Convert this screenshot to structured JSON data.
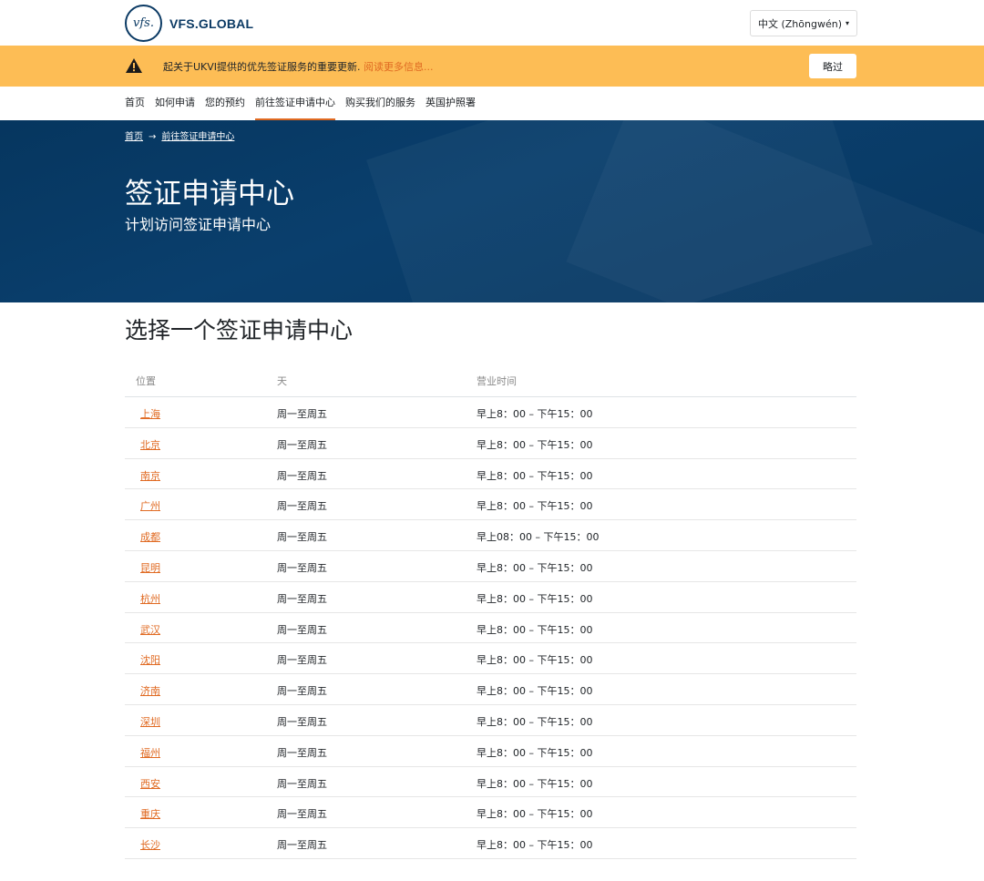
{
  "header": {
    "logo_mark": "vfs.",
    "logo_text": "VFS.GLOBAL",
    "language": "中文 (Zhōngwén)",
    "language_caret": "▾"
  },
  "alert": {
    "text": "起关于UKVI提供的优先签证服务的重要更新. ",
    "link_text": "阅读更多信息...",
    "skip_label": "略过"
  },
  "nav": {
    "items": [
      "首页",
      "如何申请",
      "您的预约",
      "前往签证申请中心",
      "购买我们的服务",
      "英国护照署"
    ],
    "active_index": 3
  },
  "breadcrumb": {
    "home": "首页",
    "arrow": "→",
    "current": "前往签证申请中心"
  },
  "hero": {
    "title": "签证申请中心",
    "subtitle": "计划访问签证申请中心"
  },
  "main": {
    "heading": "选择一个签证申请中心",
    "columns": [
      "位置",
      "天",
      "营业时间"
    ],
    "rows": [
      {
        "location": "上海",
        "days": "周一至周五",
        "hours": "早上8：00 – 下午15：00"
      },
      {
        "location": "北京",
        "days": "周一至周五",
        "hours": "早上8：00 – 下午15：00"
      },
      {
        "location": "南京",
        "days": "周一至周五",
        "hours": "早上8：00 – 下午15：00"
      },
      {
        "location": "广州",
        "days": "周一至周五",
        "hours": "早上8：00 – 下午15：00"
      },
      {
        "location": "成都",
        "days": "周一至周五",
        "hours": "早上08：00 – 下午15：00"
      },
      {
        "location": "昆明",
        "days": "周一至周五",
        "hours": "早上8：00 – 下午15：00"
      },
      {
        "location": "杭州",
        "days": "周一至周五",
        "hours": "早上8：00 – 下午15：00"
      },
      {
        "location": "武汉",
        "days": "周一至周五",
        "hours": "早上8：00 – 下午15：00"
      },
      {
        "location": "沈阳",
        "days": "周一至周五",
        "hours": "早上8：00 – 下午15：00"
      },
      {
        "location": "济南",
        "days": "周一至周五",
        "hours": "早上8：00 – 下午15：00"
      },
      {
        "location": "深圳",
        "days": "周一至周五",
        "hours": "早上8：00 – 下午15：00"
      },
      {
        "location": "福州",
        "days": "周一至周五",
        "hours": "早上8：00 – 下午15：00"
      },
      {
        "location": "西安",
        "days": "周一至周五",
        "hours": "早上8：00 – 下午15：00"
      },
      {
        "location": "重庆",
        "days": "周一至周五",
        "hours": "早上8：00 – 下午15：00"
      },
      {
        "location": "长沙",
        "days": "周一至周五",
        "hours": "早上8：00 – 下午15：00"
      }
    ]
  },
  "colors": {
    "brand_navy": "#0b3a64",
    "alert_bg": "#fdbd55",
    "accent_orange": "#e06a22",
    "hero_bg": "#06365f"
  },
  "icons": {
    "warning": "warning-icon",
    "logo": "vfs-logo-icon"
  }
}
